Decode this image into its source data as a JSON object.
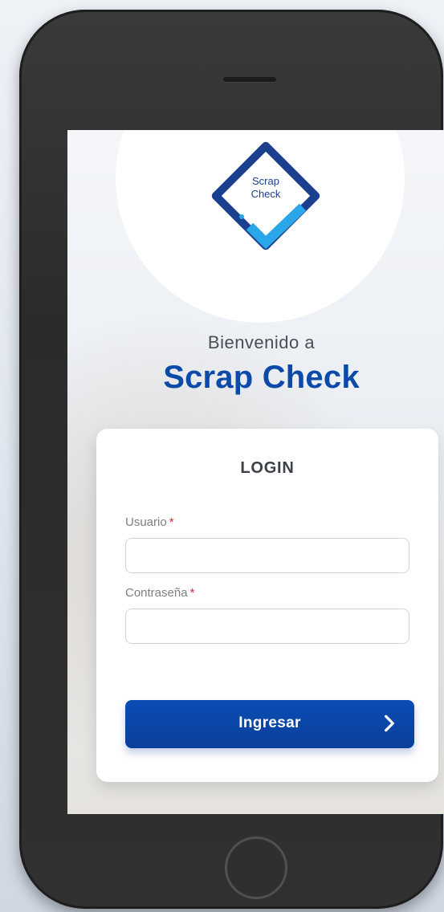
{
  "screen": {
    "welcome_text": "Bienvenido a",
    "brand_text": "Scrap Check",
    "logo": {
      "line1": "Scrap",
      "line2": "Check"
    }
  },
  "login": {
    "title": "LOGIN",
    "username": {
      "label": "Usuario",
      "required_marker": "*",
      "value": "",
      "placeholder": ""
    },
    "password": {
      "label": "Contraseña",
      "required_marker": "*",
      "value": "",
      "placeholder": ""
    },
    "submit_label": "Ingresar",
    "submit_icon": "chevron-right-icon"
  },
  "colors": {
    "brand_blue": "#0B4AA8",
    "logo_blue": "#1B3F8F",
    "accent_light_blue": "#2AA7E8",
    "required_red": "#D72B2B"
  }
}
